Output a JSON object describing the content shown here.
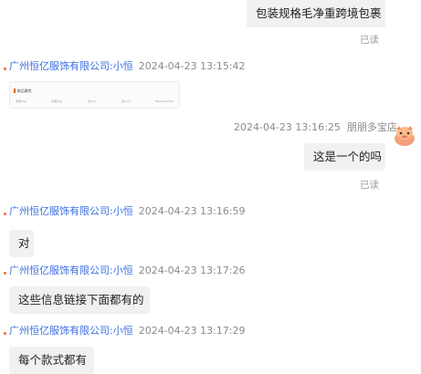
{
  "messages": [
    {
      "text": "包装规格毛净重跨境包裹",
      "read": "已读"
    },
    {
      "sender": "广州恒亿服饰有限公司:小恒",
      "time": "2024-04-23 13:15:42",
      "card": {
        "title": "| 商品属性",
        "cols": [
          "毛重(kg)",
          "净重(kg)",
          "长(cm)",
          "宽(cm)",
          "Now/Tbo/Tbo"
        ]
      }
    },
    {
      "time": "2024-04-23 13:16:25",
      "sender": "朋朋多宝店"
    },
    {
      "text": "这是一个的吗",
      "read": "已读"
    },
    {
      "sender": "广州恒亿服饰有限公司:小恒",
      "time": "2024-04-23 13:16:59",
      "text": "对"
    },
    {
      "sender": "广州恒亿服饰有限公司:小恒",
      "time": "2024-04-23 13:17:26",
      "text": "这些信息链接下面都有的"
    },
    {
      "sender": "广州恒亿服饰有限公司:小恒",
      "time": "2024-04-23 13:17:29",
      "text": "每个款式都有"
    }
  ]
}
